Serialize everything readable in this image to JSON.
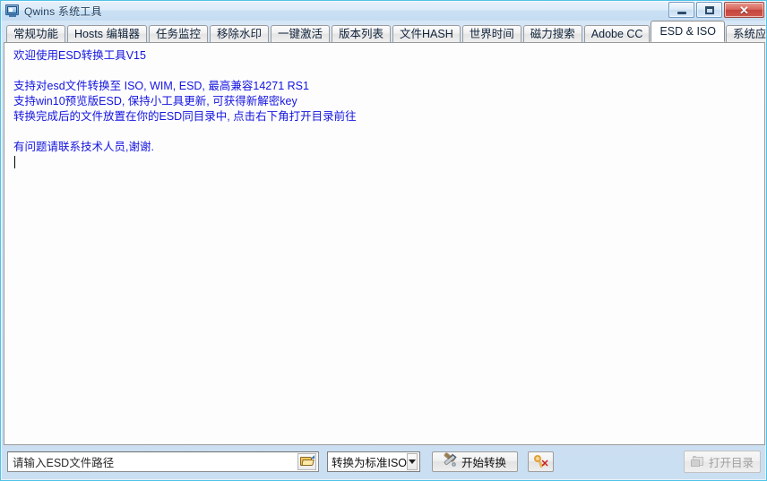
{
  "window": {
    "title": "Qwins 系统工具",
    "icon": "monitor-icon",
    "minimize_label": "",
    "maximize_label": "",
    "close_label": "✕"
  },
  "tabs": [
    {
      "label": "常规功能",
      "active": false
    },
    {
      "label": "Hosts 编辑器",
      "active": false
    },
    {
      "label": "任务监控",
      "active": false
    },
    {
      "label": "移除水印",
      "active": false
    },
    {
      "label": "一键激活",
      "active": false
    },
    {
      "label": "版本列表",
      "active": false
    },
    {
      "label": "文件HASH",
      "active": false
    },
    {
      "label": "世界时间",
      "active": false
    },
    {
      "label": "磁力搜索",
      "active": false
    },
    {
      "label": "Adobe CC",
      "active": false
    },
    {
      "label": "ESD & ISO",
      "active": true
    },
    {
      "label": "系统应用",
      "active": false
    }
  ],
  "log": {
    "text_color": "#1414e0",
    "lines": [
      "欢迎使用ESD转换工具V15",
      "",
      "支持对esd文件转换至 ISO, WIM, ESD, 最高兼容14271 RS1",
      "支持win10预览版ESD, 保持小工具更新, 可获得新解密key",
      "转换完成后的文件放置在你的ESD同目录中, 点击右下角打开目录前往",
      "",
      "有问题请联系技术人员,谢谢."
    ]
  },
  "bottom_bar": {
    "path_input": {
      "value": "",
      "placeholder": "请输入ESD文件路径",
      "display_text": "请输入ESD文件路径"
    },
    "browse_button": {
      "icon": "open-folder-icon",
      "label": ""
    },
    "convert_mode_select": {
      "selected": "转换为标准ISO",
      "options": [
        "转换为标准ISO"
      ]
    },
    "start_button": {
      "label": "开始转换",
      "icon": "tools-icon"
    },
    "clear_key_button": {
      "label": "",
      "icon": "key-remove-icon"
    },
    "open_dir_button": {
      "label": "打开目录",
      "icon": "open-folder-gray-icon",
      "disabled": true
    }
  },
  "theme": {
    "titlebar_gradient_top": "#e7f1fb",
    "titlebar_gradient_bottom": "#c5dcf2",
    "window_border": "#4ec3e8",
    "client_background": "#cfe2f4",
    "panel_background": "#fdfdfd",
    "log_text": "#1414e0",
    "close_button": "#c2453c"
  }
}
